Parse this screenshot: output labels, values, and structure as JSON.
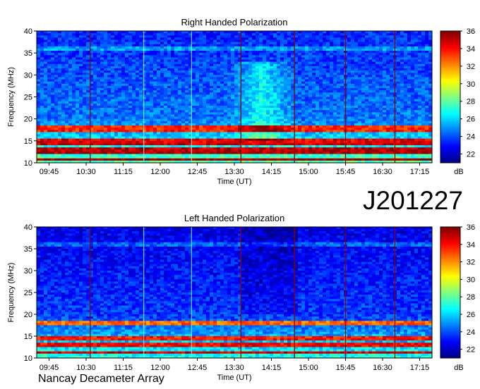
{
  "figure": {
    "id_label": "J201227",
    "footer_label": "Nancay Decameter Array"
  },
  "colors": {
    "colormap": [
      "#00007f",
      "#0000ff",
      "#0080ff",
      "#00ffff",
      "#80ff80",
      "#ffff00",
      "#ff8000",
      "#ff0000",
      "#7f0000"
    ],
    "marker_line": "#8b0000"
  },
  "chart_data": [
    {
      "type": "heatmap",
      "title": "Right Handed Polarization",
      "xlabel": "Time (UT)",
      "ylabel": "Frequency (MHz)",
      "x_ticks": [
        "09:45",
        "10:30",
        "11:15",
        "12:00",
        "12:45",
        "13:30",
        "14:15",
        "15:00",
        "15:45",
        "16:30",
        "17:15"
      ],
      "y_ticks": [
        10,
        15,
        20,
        25,
        30,
        35,
        40
      ],
      "ylim": [
        10,
        40
      ],
      "colorbar": {
        "label": "dB",
        "ticks": [
          22,
          24,
          26,
          28,
          30,
          32,
          34,
          36
        ],
        "range": [
          21,
          36
        ]
      },
      "dark_red_bands_mhz": [
        [
          10.5,
          11.2
        ],
        [
          12.2,
          13.5
        ],
        [
          14.0,
          15.3
        ],
        [
          17.2,
          18.4
        ]
      ],
      "vertical_marker_times": [
        "10:35",
        "13:38",
        "14:43",
        "15:45",
        "16:45"
      ],
      "cyan_line_times": [
        "11:40",
        "12:38"
      ]
    },
    {
      "type": "heatmap",
      "title": "Left Handed Polarization",
      "xlabel": "Time (UT)",
      "ylabel": "Frequency (MHz)",
      "x_ticks": [
        "09:45",
        "10:30",
        "11:15",
        "12:00",
        "12:45",
        "13:30",
        "14:15",
        "15:00",
        "15:45",
        "16:30",
        "17:15"
      ],
      "y_ticks": [
        10,
        15,
        20,
        25,
        30,
        35,
        40
      ],
      "ylim": [
        10,
        40
      ],
      "colorbar": {
        "label": "dB",
        "ticks": [
          22,
          24,
          26,
          28,
          30,
          32,
          34,
          36
        ],
        "range": [
          21,
          36
        ]
      },
      "dark_red_bands_mhz": [
        [
          11.0,
          11.6
        ],
        [
          12.5,
          13.5
        ],
        [
          14.0,
          15.0
        ],
        [
          17.4,
          18.4
        ]
      ],
      "vertical_marker_times": [
        "10:35",
        "13:38",
        "14:43",
        "15:45",
        "16:45"
      ],
      "cyan_line_times": [
        "11:40",
        "12:38"
      ]
    }
  ]
}
